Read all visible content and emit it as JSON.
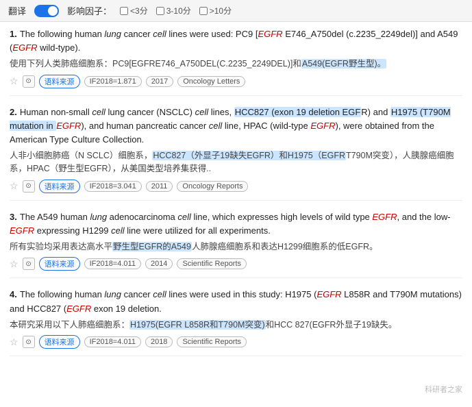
{
  "toolbar": {
    "translate_label": "翻译",
    "impact_label": "影响因子：",
    "filter1_label": "<3分",
    "filter2_label": "3-10分",
    "filter3_label": ">10分"
  },
  "results": [
    {
      "number": "1.",
      "english": "The following human {lung} cancer {cell} lines were used: PC9 [{EGFR} E746_A750del (c.2235_2249del)] and A549 ({EGFR} wild-type).",
      "english_parts": [
        {
          "text": "The following human ",
          "type": "normal"
        },
        {
          "text": "lung",
          "type": "italic"
        },
        {
          "text": " cancer ",
          "type": "normal"
        },
        {
          "text": "cell",
          "type": "italic"
        },
        {
          "text": " lines were used: PC9 [",
          "type": "normal"
        },
        {
          "text": "EGFR",
          "type": "em-italic"
        },
        {
          "text": " E746_A750del (c.2235_2249del)] and A549 (",
          "type": "normal"
        },
        {
          "text": "EGFR",
          "type": "em-italic"
        },
        {
          "text": " wild-type).",
          "type": "normal"
        }
      ],
      "chinese_parts": [
        {
          "text": "使用下列人类肺癌细胞系：PC9[EGFRE746_A750DEL(C.2235_2249DEL)]和",
          "type": "normal"
        },
        {
          "text": "A549(EGFR野生型)。",
          "type": "highlight"
        }
      ],
      "source_label": "语料来源",
      "if_label": "IF2018=1.871",
      "year": "2017",
      "journal": "Oncology Letters"
    },
    {
      "number": "2.",
      "english_parts": [
        {
          "text": "Human non-small ",
          "type": "normal"
        },
        {
          "text": "cell",
          "type": "italic"
        },
        {
          "text": " lung cancer (NSCLC) ",
          "type": "normal"
        },
        {
          "text": "cell",
          "type": "italic"
        },
        {
          "text": " lines, ",
          "type": "normal"
        },
        {
          "text": "HCC827 (exon 19 deletion EGF",
          "type": "highlight"
        },
        {
          "text": "R) and ",
          "type": "normal"
        },
        {
          "text": "H1975 (T790M mutation in ",
          "type": "highlight"
        },
        {
          "text": "EGFR",
          "type": "em-italic"
        },
        {
          "text": "), and human pancreatic cancer ",
          "type": "normal"
        },
        {
          "text": "cell",
          "type": "italic"
        },
        {
          "text": " line, HPAC (wild-type ",
          "type": "normal"
        },
        {
          "text": "EGFR",
          "type": "em-italic"
        },
        {
          "text": "), were obtained from the American Type Culture Collection.",
          "type": "normal"
        }
      ],
      "chinese_parts": [
        {
          "text": "人非小细胞肺癌（N SCLC）细胞系，",
          "type": "normal"
        },
        {
          "text": "HCC827（外显子19缺失EGFR）和H1975（EGFR",
          "type": "highlight"
        },
        {
          "text": "T790M突变），人胰腺癌细胞系，HPAC（野生型EGFR），从美国类型培养集获得..",
          "type": "normal"
        }
      ],
      "source_label": "语料来源",
      "if_label": "IF2018=3.041",
      "year": "2011",
      "journal": "Oncology Reports"
    },
    {
      "number": "3.",
      "english_parts": [
        {
          "text": "The A549 human ",
          "type": "normal"
        },
        {
          "text": "lung",
          "type": "italic"
        },
        {
          "text": " adenocarcinoma ",
          "type": "normal"
        },
        {
          "text": "cell",
          "type": "italic"
        },
        {
          "text": " line, which expresses high levels of wild type ",
          "type": "normal"
        },
        {
          "text": "EGFR",
          "type": "em-italic"
        },
        {
          "text": ", and the low-",
          "type": "normal"
        },
        {
          "text": "EGFR",
          "type": "em-italic"
        },
        {
          "text": " expressing H1299 ",
          "type": "normal"
        },
        {
          "text": "cell",
          "type": "italic"
        },
        {
          "text": " line were utilized for all experiments.",
          "type": "normal"
        }
      ],
      "chinese_parts": [
        {
          "text": "所有实验均采用表达高水平",
          "type": "normal"
        },
        {
          "text": "野生型EGFR的A549",
          "type": "highlight"
        },
        {
          "text": "人肺腺癌细胞系和表达H1299细胞系的低EGFR。",
          "type": "normal"
        }
      ],
      "source_label": "语料来源",
      "if_label": "IF2018=4.011",
      "year": "2014",
      "journal": "Scientific Reports"
    },
    {
      "number": "4.",
      "english_parts": [
        {
          "text": "The following human ",
          "type": "normal"
        },
        {
          "text": "lung",
          "type": "italic"
        },
        {
          "text": " cancer ",
          "type": "normal"
        },
        {
          "text": "cell",
          "type": "italic"
        },
        {
          "text": " lines were used in this study: H1975 (",
          "type": "normal"
        },
        {
          "text": "EGFR",
          "type": "em-italic"
        },
        {
          "text": " L858R and T790M mutations) and HCC827 (",
          "type": "normal"
        },
        {
          "text": "EGFR",
          "type": "em-italic"
        },
        {
          "text": " exon 19 deletion.",
          "type": "normal"
        }
      ],
      "chinese_parts": [
        {
          "text": "本研究采用以下人肺癌细胞系：",
          "type": "normal"
        },
        {
          "text": "H1975(EGFR L858R和T790M突变)",
          "type": "highlight"
        },
        {
          "text": "和HCC 827(EGFR外显子19缺失。",
          "type": "normal"
        }
      ],
      "source_label": "语料来源",
      "if_label": "IF2018=4.011",
      "year": "2018",
      "journal": "Scientific Reports"
    }
  ],
  "watermark": "科研者之家"
}
